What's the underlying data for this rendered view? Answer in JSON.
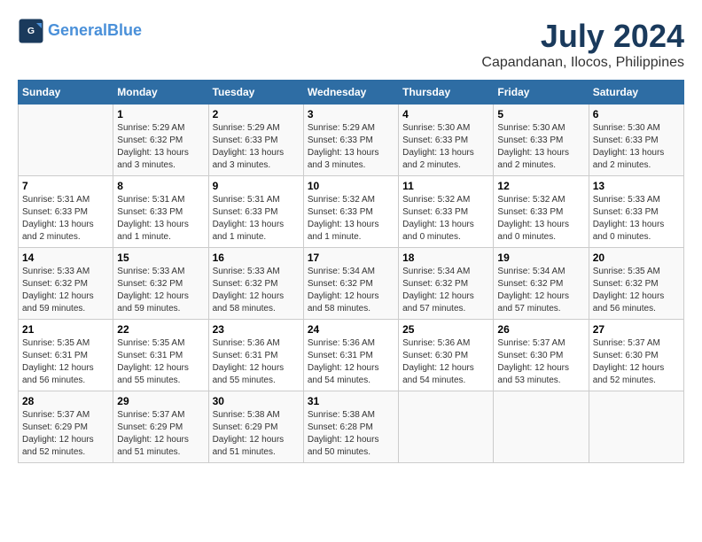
{
  "header": {
    "logo_line1": "General",
    "logo_line2": "Blue",
    "month_year": "July 2024",
    "location": "Capandanan, Ilocos, Philippines"
  },
  "calendar": {
    "days_of_week": [
      "Sunday",
      "Monday",
      "Tuesday",
      "Wednesday",
      "Thursday",
      "Friday",
      "Saturday"
    ],
    "weeks": [
      [
        {
          "day": "",
          "info": ""
        },
        {
          "day": "1",
          "info": "Sunrise: 5:29 AM\nSunset: 6:32 PM\nDaylight: 13 hours\nand 3 minutes."
        },
        {
          "day": "2",
          "info": "Sunrise: 5:29 AM\nSunset: 6:33 PM\nDaylight: 13 hours\nand 3 minutes."
        },
        {
          "day": "3",
          "info": "Sunrise: 5:29 AM\nSunset: 6:33 PM\nDaylight: 13 hours\nand 3 minutes."
        },
        {
          "day": "4",
          "info": "Sunrise: 5:30 AM\nSunset: 6:33 PM\nDaylight: 13 hours\nand 2 minutes."
        },
        {
          "day": "5",
          "info": "Sunrise: 5:30 AM\nSunset: 6:33 PM\nDaylight: 13 hours\nand 2 minutes."
        },
        {
          "day": "6",
          "info": "Sunrise: 5:30 AM\nSunset: 6:33 PM\nDaylight: 13 hours\nand 2 minutes."
        }
      ],
      [
        {
          "day": "7",
          "info": "Sunrise: 5:31 AM\nSunset: 6:33 PM\nDaylight: 13 hours\nand 2 minutes."
        },
        {
          "day": "8",
          "info": "Sunrise: 5:31 AM\nSunset: 6:33 PM\nDaylight: 13 hours\nand 1 minute."
        },
        {
          "day": "9",
          "info": "Sunrise: 5:31 AM\nSunset: 6:33 PM\nDaylight: 13 hours\nand 1 minute."
        },
        {
          "day": "10",
          "info": "Sunrise: 5:32 AM\nSunset: 6:33 PM\nDaylight: 13 hours\nand 1 minute."
        },
        {
          "day": "11",
          "info": "Sunrise: 5:32 AM\nSunset: 6:33 PM\nDaylight: 13 hours\nand 0 minutes."
        },
        {
          "day": "12",
          "info": "Sunrise: 5:32 AM\nSunset: 6:33 PM\nDaylight: 13 hours\nand 0 minutes."
        },
        {
          "day": "13",
          "info": "Sunrise: 5:33 AM\nSunset: 6:33 PM\nDaylight: 13 hours\nand 0 minutes."
        }
      ],
      [
        {
          "day": "14",
          "info": "Sunrise: 5:33 AM\nSunset: 6:32 PM\nDaylight: 12 hours\nand 59 minutes."
        },
        {
          "day": "15",
          "info": "Sunrise: 5:33 AM\nSunset: 6:32 PM\nDaylight: 12 hours\nand 59 minutes."
        },
        {
          "day": "16",
          "info": "Sunrise: 5:33 AM\nSunset: 6:32 PM\nDaylight: 12 hours\nand 58 minutes."
        },
        {
          "day": "17",
          "info": "Sunrise: 5:34 AM\nSunset: 6:32 PM\nDaylight: 12 hours\nand 58 minutes."
        },
        {
          "day": "18",
          "info": "Sunrise: 5:34 AM\nSunset: 6:32 PM\nDaylight: 12 hours\nand 57 minutes."
        },
        {
          "day": "19",
          "info": "Sunrise: 5:34 AM\nSunset: 6:32 PM\nDaylight: 12 hours\nand 57 minutes."
        },
        {
          "day": "20",
          "info": "Sunrise: 5:35 AM\nSunset: 6:32 PM\nDaylight: 12 hours\nand 56 minutes."
        }
      ],
      [
        {
          "day": "21",
          "info": "Sunrise: 5:35 AM\nSunset: 6:31 PM\nDaylight: 12 hours\nand 56 minutes."
        },
        {
          "day": "22",
          "info": "Sunrise: 5:35 AM\nSunset: 6:31 PM\nDaylight: 12 hours\nand 55 minutes."
        },
        {
          "day": "23",
          "info": "Sunrise: 5:36 AM\nSunset: 6:31 PM\nDaylight: 12 hours\nand 55 minutes."
        },
        {
          "day": "24",
          "info": "Sunrise: 5:36 AM\nSunset: 6:31 PM\nDaylight: 12 hours\nand 54 minutes."
        },
        {
          "day": "25",
          "info": "Sunrise: 5:36 AM\nSunset: 6:30 PM\nDaylight: 12 hours\nand 54 minutes."
        },
        {
          "day": "26",
          "info": "Sunrise: 5:37 AM\nSunset: 6:30 PM\nDaylight: 12 hours\nand 53 minutes."
        },
        {
          "day": "27",
          "info": "Sunrise: 5:37 AM\nSunset: 6:30 PM\nDaylight: 12 hours\nand 52 minutes."
        }
      ],
      [
        {
          "day": "28",
          "info": "Sunrise: 5:37 AM\nSunset: 6:29 PM\nDaylight: 12 hours\nand 52 minutes."
        },
        {
          "day": "29",
          "info": "Sunrise: 5:37 AM\nSunset: 6:29 PM\nDaylight: 12 hours\nand 51 minutes."
        },
        {
          "day": "30",
          "info": "Sunrise: 5:38 AM\nSunset: 6:29 PM\nDaylight: 12 hours\nand 51 minutes."
        },
        {
          "day": "31",
          "info": "Sunrise: 5:38 AM\nSunset: 6:28 PM\nDaylight: 12 hours\nand 50 minutes."
        },
        {
          "day": "",
          "info": ""
        },
        {
          "day": "",
          "info": ""
        },
        {
          "day": "",
          "info": ""
        }
      ]
    ]
  }
}
